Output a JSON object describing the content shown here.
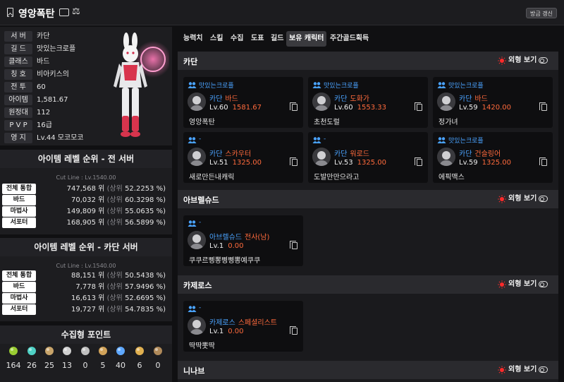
{
  "header": {
    "title": "영앙폭탄",
    "refresh_label": "방금 갱신"
  },
  "profile": {
    "stats": [
      {
        "key": "서 버",
        "value": "카단"
      },
      {
        "key": "길 드",
        "value": "맛있는크로플"
      },
      {
        "key": "클래스",
        "value": "바드"
      },
      {
        "key": "칭 호",
        "value": "비아키스의"
      },
      {
        "key": "전 투",
        "value": "60"
      },
      {
        "key": "아이템",
        "value": "1,581.67"
      },
      {
        "key": "원정대",
        "value": "112"
      },
      {
        "key": "P V P",
        "value": "16급"
      },
      {
        "key": "영 지",
        "value": "Lv.44 모코모코"
      }
    ]
  },
  "rank_all": {
    "title": "아이템 레벨 순위 - 전 서버",
    "cutline": "Cut Line : Lv.1540.00",
    "rows": [
      {
        "key": "전체 통합",
        "rank": "747,568 위",
        "paren": "(상위",
        "pct": "52.2253 %)"
      },
      {
        "key": "바드",
        "rank": "70,032 위",
        "paren": "(상위",
        "pct": "60.3298 %)"
      },
      {
        "key": "마법사",
        "rank": "149,809 위",
        "paren": "(상위",
        "pct": "55.0635 %)"
      },
      {
        "key": "서포터",
        "rank": "168,905 위",
        "paren": "(상위",
        "pct": "56.5899 %)"
      }
    ]
  },
  "rank_server": {
    "title": "아이템 레벨 순위 - 카단 서버",
    "cutline": "Cut Line : Lv.1540.00",
    "rows": [
      {
        "key": "전체 통합",
        "rank": "88,151 위",
        "paren": "(상위",
        "pct": "50.5438 %)"
      },
      {
        "key": "바드",
        "rank": "7,778 위",
        "paren": "(상위",
        "pct": "57.9496 %)"
      },
      {
        "key": "마법사",
        "rank": "16,613 위",
        "paren": "(상위",
        "pct": "52.6695 %)"
      },
      {
        "key": "서포터",
        "rank": "19,727 위",
        "paren": "(상위",
        "pct": "54.7835 %)"
      }
    ]
  },
  "collect": {
    "title": "수집형 포인트",
    "items": [
      {
        "icon": "mokoko-seed-icon",
        "count": "164",
        "color": "#9acd32"
      },
      {
        "icon": "island-heart-icon",
        "count": "26",
        "color": "#4fd1c5"
      },
      {
        "icon": "great-art-icon",
        "count": "25",
        "color": "#c8a46a"
      },
      {
        "icon": "giant-heart-icon",
        "count": "13",
        "color": "#d0d0d0"
      },
      {
        "icon": "ignea-token-icon",
        "count": "0",
        "color": "#c0c0c0"
      },
      {
        "icon": "orpheus-star-icon",
        "count": "5",
        "color": "#d2a35a"
      },
      {
        "icon": "world-tree-leaf-icon",
        "count": "40",
        "color": "#5fa8ff"
      },
      {
        "icon": "sea-bounty-icon",
        "count": "6",
        "color": "#e0b050"
      },
      {
        "icon": "omnium-star-icon",
        "count": "0",
        "color": "#b08a5a"
      }
    ]
  },
  "tabs": [
    {
      "label": "능력치",
      "active": false
    },
    {
      "label": "스킬",
      "active": false
    },
    {
      "label": "수집",
      "active": false
    },
    {
      "label": "도표",
      "active": false
    },
    {
      "label": "길드",
      "active": false
    },
    {
      "label": "보유 캐릭터",
      "active": true
    },
    {
      "label": "주간골드획득",
      "active": false
    }
  ],
  "toggle_label": "외형 보기",
  "colors": {
    "guild": "#4aa3ff",
    "class": "#ff6a3c",
    "bulb": "#ff2a2a"
  },
  "servers": [
    {
      "name": "카단",
      "characters": [
        {
          "guild": "맛있는크로플",
          "server": "카단",
          "class": "바드",
          "level": "Lv.60",
          "item_level": "1581.67",
          "name": "영앙폭탄"
        },
        {
          "guild": "맛있는크로플",
          "server": "카단",
          "class": "도화가",
          "level": "Lv.60",
          "item_level": "1553.33",
          "name": "초천도럴"
        },
        {
          "guild": "맛있는크로플",
          "server": "카단",
          "class": "바드",
          "level": "Lv.59",
          "item_level": "1420.00",
          "name": "정가녀"
        },
        {
          "guild": "-",
          "server": "카단",
          "class": "스카우터",
          "level": "Lv.51",
          "item_level": "1325.00",
          "name": "새로만든내캐릭"
        },
        {
          "guild": "-",
          "server": "카단",
          "class": "워로드",
          "level": "Lv.53",
          "item_level": "1325.00",
          "name": "도발만만으라고"
        },
        {
          "guild": "맛있는크로플",
          "server": "카단",
          "class": "건슬링어",
          "level": "Lv.59",
          "item_level": "1325.00",
          "name": "에픽맥스"
        }
      ]
    },
    {
      "name": "아브렐슈드",
      "characters": [
        {
          "guild": "-",
          "server": "아브렐슈드",
          "class": "전사(남)",
          "level": "Lv.1",
          "item_level": "0.00",
          "name": "쿠쿠르삥뽕삥삥뽕예쿠쿠"
        }
      ]
    },
    {
      "name": "카제로스",
      "characters": [
        {
          "guild": "-",
          "server": "카제로스",
          "class": "스페셜리스트",
          "level": "Lv.1",
          "item_level": "0.00",
          "name": "딱딱뽓딱"
        }
      ]
    },
    {
      "name": "니나브",
      "characters": []
    }
  ]
}
